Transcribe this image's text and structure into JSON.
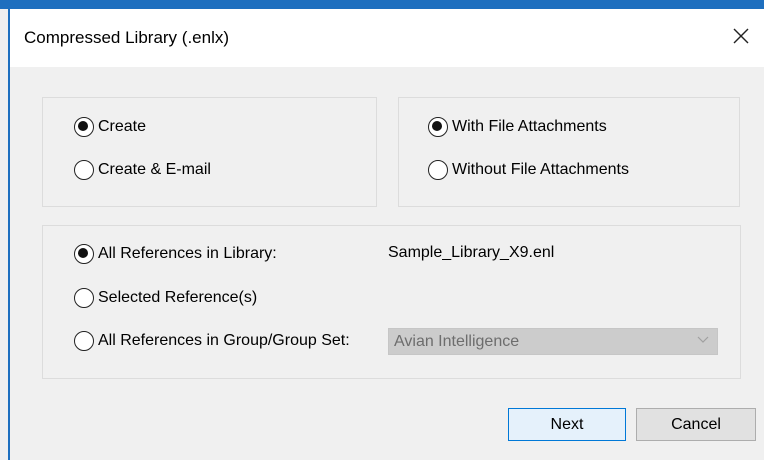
{
  "window": {
    "title": "Compressed Library (.enlx)"
  },
  "action_group": {
    "options": [
      {
        "label": "Create",
        "checked": true
      },
      {
        "label": "Create & E-mail",
        "checked": false
      }
    ]
  },
  "attachments_group": {
    "options": [
      {
        "label": "With File Attachments",
        "checked": true
      },
      {
        "label": "Without File Attachments",
        "checked": false
      }
    ]
  },
  "references_group": {
    "options": [
      {
        "label": "All References in Library:",
        "checked": true
      },
      {
        "label": "Selected Reference(s)",
        "checked": false
      },
      {
        "label": "All References in Group/Group Set:",
        "checked": false
      }
    ],
    "library_name": "Sample_Library_X9.enl",
    "group_select": {
      "value": "Avian Intelligence",
      "enabled": false
    }
  },
  "buttons": {
    "next": "Next",
    "cancel": "Cancel"
  },
  "colors": {
    "accent": "#0078d7",
    "window_border": "#1e6fbf",
    "background": "#f0f0f0"
  }
}
